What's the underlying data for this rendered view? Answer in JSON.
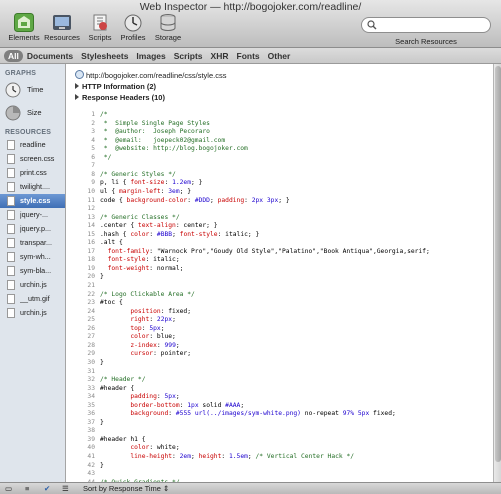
{
  "window": {
    "title": "Web Inspector — http://bogojoker.com/readline/"
  },
  "toolbar": {
    "buttons": [
      {
        "label": "Elements",
        "icon": "elements-icon"
      },
      {
        "label": "Resources",
        "icon": "resources-icon"
      },
      {
        "label": "Scripts",
        "icon": "scripts-icon"
      },
      {
        "label": "Profiles",
        "icon": "profiles-icon"
      },
      {
        "label": "Storage",
        "icon": "storage-icon"
      }
    ],
    "search": {
      "label": "Search Resources",
      "value": "",
      "placeholder": ""
    }
  },
  "filters": [
    "All",
    "Documents",
    "Stylesheets",
    "Images",
    "Scripts",
    "XHR",
    "Fonts",
    "Other"
  ],
  "selected_filter": "All",
  "sidebar": {
    "graphs_header": "GRAPHS",
    "graphs": [
      {
        "label": "Time",
        "icon": "clock-icon"
      },
      {
        "label": "Size",
        "icon": "pie-chart-icon"
      }
    ],
    "resources_header": "RESOURCES",
    "resources": [
      {
        "label": "readline"
      },
      {
        "label": "screen.css"
      },
      {
        "label": "print.css"
      },
      {
        "label": "twilight...."
      },
      {
        "label": "style.css"
      },
      {
        "label": "jquery-..."
      },
      {
        "label": "jquery.p..."
      },
      {
        "label": "transpar..."
      },
      {
        "label": "sym-wh..."
      },
      {
        "label": "sym-bla..."
      },
      {
        "label": "urchin.js"
      },
      {
        "label": "__utm.gif"
      },
      {
        "label": "urchin.js"
      }
    ],
    "selected_resource": "style.css"
  },
  "content": {
    "url": "http://bogojoker.com/readline/css/style.css",
    "sections": [
      "HTTP Information (2)",
      "Response Headers (10)"
    ],
    "code_lines": [
      {
        "n": "1",
        "t": "/*"
      },
      {
        "n": "2",
        "t": " *  Simple Single Page Styles"
      },
      {
        "n": "3",
        "t": " *  @author:  Joseph Pecoraro"
      },
      {
        "n": "4",
        "t": " *  @email:   joepeck02@gmail.com"
      },
      {
        "n": "5",
        "t": " *  @website: http://blog.bogojoker.com"
      },
      {
        "n": "6",
        "t": " */"
      },
      {
        "n": "7",
        "t": ""
      },
      {
        "n": "8",
        "t": "/* Generic Styles */"
      },
      {
        "n": "9",
        "t": "p, li { font-size: 1.2em; }"
      },
      {
        "n": "10",
        "t": "ul { margin-left: 3em; }"
      },
      {
        "n": "11",
        "t": "code { background-color: #DDD; padding: 2px 3px; }"
      },
      {
        "n": "12",
        "t": ""
      },
      {
        "n": "13",
        "t": "/* Generic Classes */"
      },
      {
        "n": "14",
        "t": ".center { text-align: center; }"
      },
      {
        "n": "15",
        "t": ".hash { color: #BBB; font-style: italic; }"
      },
      {
        "n": "16",
        "t": ".alt {"
      },
      {
        "n": "17",
        "t": "  font-family: \"Warnock Pro\",\"Goudy Old Style\",\"Palatino\",\"Book Antiqua\",Georgia,serif;"
      },
      {
        "n": "18",
        "t": "  font-style: italic;"
      },
      {
        "n": "19",
        "t": "  font-weight: normal;"
      },
      {
        "n": "20",
        "t": "}"
      },
      {
        "n": "21",
        "t": ""
      },
      {
        "n": "22",
        "t": "/* Logo Clickable Area */"
      },
      {
        "n": "23",
        "t": "#toc {"
      },
      {
        "n": "24",
        "t": "        position: fixed;"
      },
      {
        "n": "25",
        "t": "        right: 22px;"
      },
      {
        "n": "26",
        "t": "        top: 5px;"
      },
      {
        "n": "27",
        "t": "        color: blue;"
      },
      {
        "n": "28",
        "t": "        z-index: 999;"
      },
      {
        "n": "29",
        "t": "        cursor: pointer;"
      },
      {
        "n": "30",
        "t": "}"
      },
      {
        "n": "31",
        "t": ""
      },
      {
        "n": "32",
        "t": "/* Header */"
      },
      {
        "n": "33",
        "t": "#header {"
      },
      {
        "n": "34",
        "t": "        padding: 5px;"
      },
      {
        "n": "35",
        "t": "        border-bottom: 1px solid #AAA;"
      },
      {
        "n": "36",
        "t": "        background: #555 url(../images/sym-white.png) no-repeat 97% 5px fixed;"
      },
      {
        "n": "37",
        "t": "}"
      },
      {
        "n": "38",
        "t": ""
      },
      {
        "n": "39",
        "t": "#header h1 {"
      },
      {
        "n": "40",
        "t": "        color: white;"
      },
      {
        "n": "41",
        "t": "        line-height: 2em; height: 1.5em; /* Vertical Center Hack */"
      },
      {
        "n": "42",
        "t": "}"
      },
      {
        "n": "43",
        "t": ""
      },
      {
        "n": "44",
        "t": "/* Quick Gradients */"
      }
    ]
  },
  "statusbar": {
    "sort_label": "Sort by Response Time"
  },
  "colors": {
    "selection": "#3f6fb5",
    "comment": "#236e25",
    "property": "#c80000",
    "value": "#1c00cf"
  }
}
